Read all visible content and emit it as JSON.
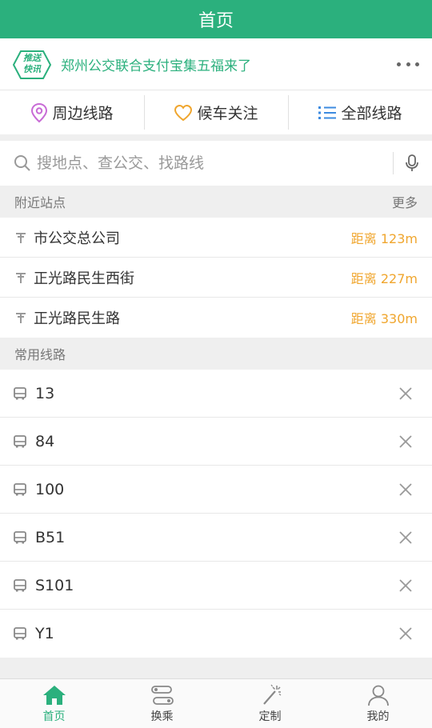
{
  "header": {
    "title": "首页"
  },
  "notice": {
    "badge_text_line1": "推送",
    "badge_text_line2": "快讯",
    "text": "郑州公交联合支付宝集五福来了"
  },
  "quick_nav": [
    {
      "label": "周边线路",
      "icon": "location-pin-icon"
    },
    {
      "label": "候车关注",
      "icon": "heart-icon"
    },
    {
      "label": "全部线路",
      "icon": "list-icon"
    }
  ],
  "search": {
    "placeholder": "搜地点、查公交、找路线"
  },
  "nearby": {
    "title": "附近站点",
    "more": "更多",
    "stops": [
      {
        "name": "市公交总公司",
        "distance": "距离 123m"
      },
      {
        "name": "正光路民生西街",
        "distance": "距离 227m"
      },
      {
        "name": "正光路民生路",
        "distance": "距离 330m"
      }
    ]
  },
  "frequent": {
    "title": "常用线路",
    "routes": [
      {
        "name": "13"
      },
      {
        "name": "84"
      },
      {
        "name": "100"
      },
      {
        "name": "B51"
      },
      {
        "name": "S101"
      },
      {
        "name": "Y1"
      }
    ]
  },
  "tabs": [
    {
      "label": "首页",
      "icon": "home-icon",
      "active": true
    },
    {
      "label": "换乘",
      "icon": "transfer-icon",
      "active": false
    },
    {
      "label": "定制",
      "icon": "magic-wand-icon",
      "active": false
    },
    {
      "label": "我的",
      "icon": "user-icon",
      "active": false
    }
  ],
  "colors": {
    "brand": "#2bb07d",
    "distance": "#f0a62e",
    "heart": "#f0a62e",
    "pin": "#c86bd6",
    "list": "#3d8be0"
  }
}
